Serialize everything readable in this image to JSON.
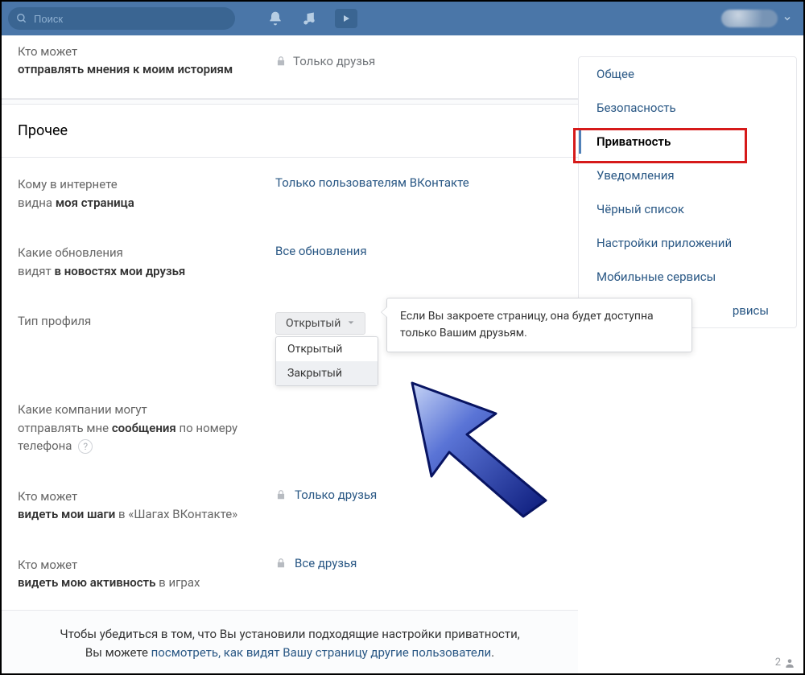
{
  "topbar": {
    "search_placeholder": "Поиск"
  },
  "history_row": {
    "label_light": "Кто может",
    "label_bold": "отправлять мнения к моим историям",
    "value": "Только друзья"
  },
  "section_other_title": "Прочее",
  "rows": {
    "visibility": {
      "label_prefix": "Кому в интернете",
      "label_light": "видна ",
      "label_bold": "моя страница",
      "value": "Только пользователям ВКонтакте"
    },
    "updates": {
      "label_prefix": "Какие обновления",
      "label_light": "видят ",
      "label_bold": "в новостях мои друзья",
      "value": "Все обновления"
    },
    "profile_type": {
      "label": "Тип профиля",
      "selected": "Открытый",
      "options": [
        "Открытый",
        "Закрытый"
      ],
      "tooltip": "Если Вы закроете страницу, она будет доступна только Вашим друзьям."
    },
    "companies": {
      "label_prefix": "Какие компании могут",
      "label_light1": "отправлять мне ",
      "label_bold": "сообщения",
      "label_light2": " по номеру телефона"
    },
    "steps": {
      "label_prefix": "Кто может",
      "label_bold": "видеть мои шаги",
      "label_light": " в «Шагах ВКонтакте»",
      "value": "Только друзья"
    },
    "games": {
      "label_prefix": "Кто может",
      "label_bold": "видеть мою активность",
      "label_light": " в играх",
      "value": "Все друзья"
    }
  },
  "footer": {
    "text1": "Чтобы убедиться в том, что Вы установили подходящие настройки приватности,",
    "text2_prefix": "Вы можете ",
    "link": "посмотреть, как видят Вашу страницу другие пользователи",
    "text2_suffix": "."
  },
  "sidebar": {
    "items": [
      "Общее",
      "Безопасность",
      "Приватность",
      "Уведомления",
      "Чёрный список",
      "Настройки приложений",
      "Мобильные сервисы"
    ],
    "partial_item_suffix": "рвисы",
    "active_index": 2
  },
  "bottom_count": "2"
}
